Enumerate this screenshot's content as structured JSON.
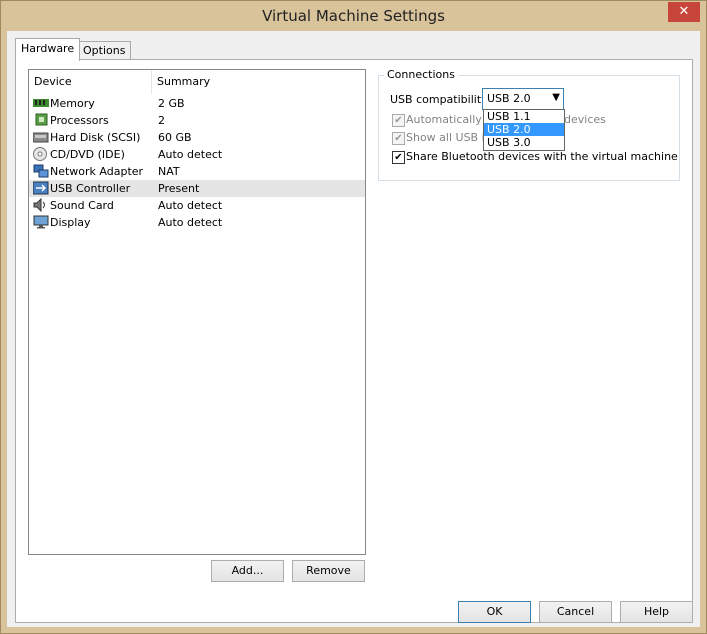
{
  "window": {
    "title": "Virtual Machine Settings",
    "close_glyph": "✕"
  },
  "tabs": [
    {
      "label": "Hardware"
    },
    {
      "label": "Options"
    }
  ],
  "device_list": {
    "headers": {
      "device": "Device",
      "summary": "Summary"
    },
    "rows": [
      {
        "device": "Memory",
        "summary": "2 GB",
        "icon": "memory-icon"
      },
      {
        "device": "Processors",
        "summary": "2",
        "icon": "processor-icon"
      },
      {
        "device": "Hard Disk (SCSI)",
        "summary": "60 GB",
        "icon": "hard-disk-icon"
      },
      {
        "device": "CD/DVD (IDE)",
        "summary": "Auto detect",
        "icon": "cd-dvd-icon"
      },
      {
        "device": "Network Adapter",
        "summary": "NAT",
        "icon": "network-adapter-icon"
      },
      {
        "device": "USB Controller",
        "summary": "Present",
        "icon": "usb-icon"
      },
      {
        "device": "Sound Card",
        "summary": "Auto detect",
        "icon": "speaker-icon"
      },
      {
        "device": "Display",
        "summary": "Auto detect",
        "icon": "monitor-icon"
      }
    ]
  },
  "list_buttons": {
    "add": "Add...",
    "remove": "Remove"
  },
  "connections": {
    "group_label": "Connections",
    "usb_label": "USB compatibility:",
    "usb_value": "USB 2.0",
    "auto_connect_label_a": "Automatically co",
    "auto_connect_label_b": "devices",
    "show_usb_label": "Show all USB inp",
    "bluetooth_label": "Share Bluetooth devices with the virtual machine",
    "options": [
      "USB 1.1",
      "USB 2.0",
      "USB 3.0"
    ]
  },
  "footer": {
    "ok": "OK",
    "cancel": "Cancel",
    "help": "Help"
  },
  "colors": {
    "selection": "#3399ff",
    "title_close": "#c7453a",
    "window_frame": "#d8c39a"
  }
}
